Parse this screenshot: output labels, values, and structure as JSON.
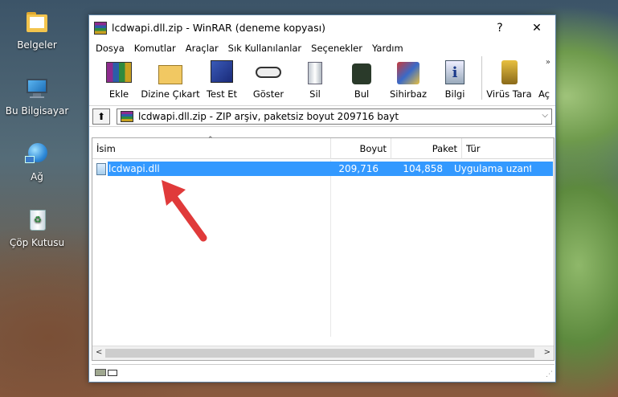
{
  "desktop": {
    "icons": [
      {
        "label": "Belgeler",
        "icon": "documents-folder-icon"
      },
      {
        "label": "Bu Bilgisayar",
        "icon": "this-pc-icon"
      },
      {
        "label": "Ağ",
        "icon": "network-icon"
      },
      {
        "label": "Çöp Kutusu",
        "icon": "recycle-bin-icon"
      }
    ]
  },
  "window": {
    "title": "lcdwapi.dll.zip - WinRAR (deneme kopyası)",
    "help_glyph": "?",
    "close_glyph": "✕"
  },
  "menu": [
    "Dosya",
    "Komutlar",
    "Araçlar",
    "Sık Kullanılanlar",
    "Seçenekler",
    "Yardım"
  ],
  "toolbar": {
    "buttons": [
      "Ekle",
      "Dizine Çıkart",
      "Test Et",
      "Göster",
      "Sil",
      "Bul",
      "Sihirbaz",
      "Bilgi",
      "Virüs Tara",
      "Aç"
    ],
    "overflow_glyph": "»"
  },
  "pathbar": {
    "path": "lcdwapi.dll.zip - ZIP arşiv, paketsiz boyut 209716 bayt",
    "up_glyph": "⬆",
    "dropdown_glyph": "⌵"
  },
  "filelist": {
    "columns": [
      "İsim",
      "Boyut",
      "Paket",
      "Tür"
    ],
    "sort_glyph": "⌃",
    "rows": [
      {
        "name": "lcdwapi.dll",
        "size": "209,716",
        "packed": "104,858",
        "type": "Uygulama uzantısı"
      }
    ]
  },
  "scroll": {
    "left_glyph": "<",
    "right_glyph": ">"
  },
  "colors": {
    "selection": "#3399ff",
    "arrow": "#e03a3a"
  }
}
